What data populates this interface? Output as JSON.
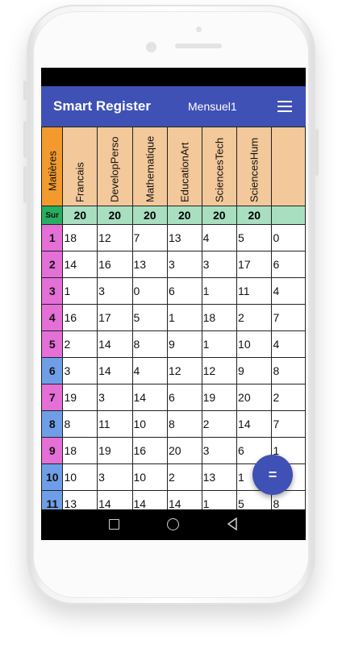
{
  "app": {
    "title": "Smart Register",
    "subtitle": "Mensuel1"
  },
  "table": {
    "corner_label": "Matières",
    "subjects": [
      "Francais",
      "DevelopPerso",
      "Mathematique",
      "EducationArt",
      "SciencesTech",
      "SciencesHum",
      ""
    ],
    "sur_label": "Sur",
    "sur_values": [
      "20",
      "20",
      "20",
      "20",
      "20",
      "20",
      ""
    ],
    "rows": [
      {
        "index": "1",
        "color": "pink",
        "values": [
          "18",
          "12",
          "7",
          "13",
          "4",
          "5",
          "0"
        ]
      },
      {
        "index": "2",
        "color": "pink",
        "values": [
          "14",
          "16",
          "13",
          "3",
          "3",
          "17",
          "6"
        ]
      },
      {
        "index": "3",
        "color": "pink",
        "values": [
          "1",
          "3",
          "0",
          "6",
          "1",
          "11",
          "4"
        ]
      },
      {
        "index": "4",
        "color": "pink",
        "values": [
          "16",
          "17",
          "5",
          "1",
          "18",
          "2",
          "7"
        ]
      },
      {
        "index": "5",
        "color": "pink",
        "values": [
          "2",
          "14",
          "8",
          "9",
          "1",
          "10",
          "4"
        ]
      },
      {
        "index": "6",
        "color": "blue",
        "values": [
          "3",
          "14",
          "4",
          "12",
          "12",
          "9",
          "8"
        ]
      },
      {
        "index": "7",
        "color": "pink",
        "values": [
          "19",
          "3",
          "14",
          "6",
          "19",
          "20",
          "2"
        ]
      },
      {
        "index": "8",
        "color": "blue",
        "values": [
          "8",
          "11",
          "10",
          "8",
          "2",
          "14",
          "7"
        ]
      },
      {
        "index": "9",
        "color": "pink",
        "values": [
          "18",
          "19",
          "16",
          "20",
          "3",
          "6",
          "1"
        ]
      },
      {
        "index": "10",
        "color": "blue",
        "values": [
          "10",
          "3",
          "10",
          "2",
          "13",
          "1",
          "0"
        ]
      },
      {
        "index": "11",
        "color": "blue",
        "values": [
          "13",
          "14",
          "14",
          "14",
          "1",
          "5",
          "8"
        ]
      }
    ]
  },
  "fab": {
    "icon": "equals-icon",
    "label": "="
  },
  "navbar": {
    "icons": [
      "recent-apps-icon",
      "home-icon",
      "back-icon"
    ]
  },
  "colors": {
    "appbar": "#3f51b5",
    "header": "#f3c89a",
    "corner": "#f29a2e",
    "sur": "#a8dfc0",
    "pink": "#e36fd7",
    "blue": "#6f9ee8"
  }
}
